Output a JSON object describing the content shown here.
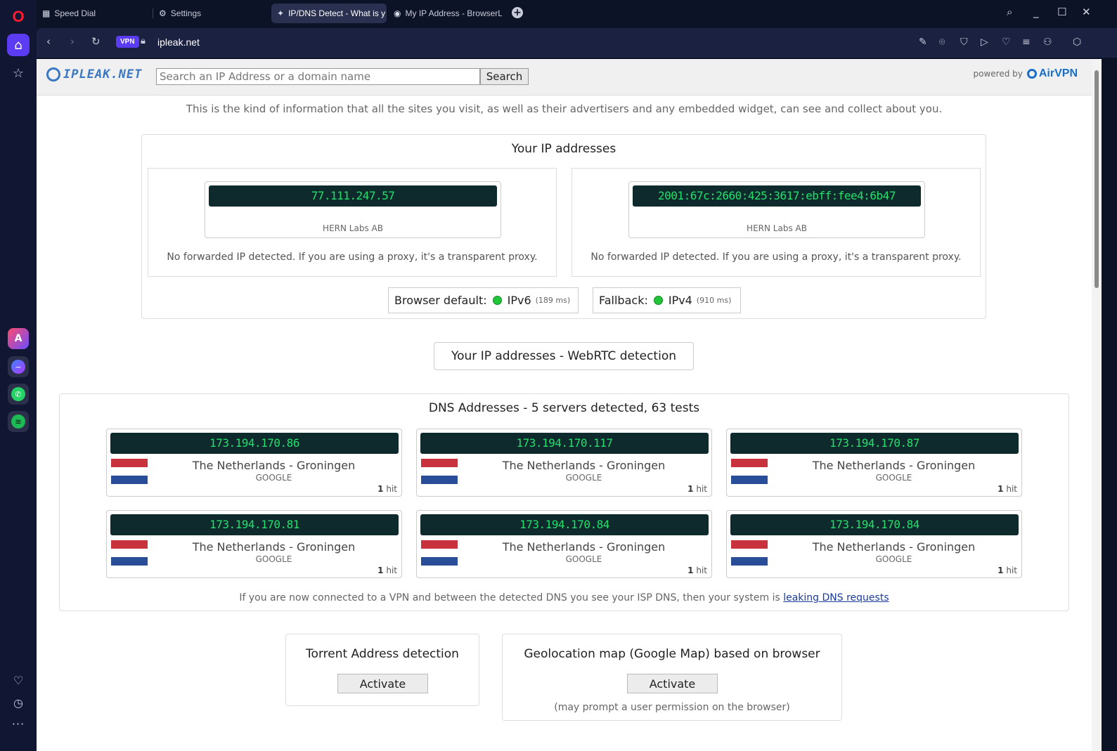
{
  "tabs": [
    {
      "label": "Speed Dial",
      "icon": "grid-icon"
    },
    {
      "label": "Settings",
      "icon": "gear-icon"
    },
    {
      "label": "IP/DNS Detect - What is y",
      "icon": "ipleak-favicon"
    },
    {
      "label": "My IP Address - BrowserL",
      "icon": "browserleaks-favicon"
    }
  ],
  "addressbar": {
    "vpn_label": "VPN",
    "url": "ipleak.net"
  },
  "site": {
    "logo_text": "IPLEAK.NET",
    "search_placeholder": "Search an IP Address or a domain name",
    "search_button": "Search",
    "powered_by": "powered by",
    "airvpn": "AirVPN"
  },
  "intro": "This is the kind of information that all the sites you visit, as well as their advertisers and any embedded widget, can see and collect about you.",
  "ip_section": {
    "title": "Your IP addresses",
    "addresses": [
      {
        "ip": "77.111.247.57",
        "isp": "HERN Labs AB",
        "forwarded": "No forwarded IP detected. If you are using a proxy, it's a transparent proxy."
      },
      {
        "ip": "2001:67c:2660:425:3617:ebff:fee4:6b47",
        "isp": "HERN Labs AB",
        "forwarded": "No forwarded IP detected. If you are using a proxy, it's a transparent proxy."
      }
    ],
    "browser_default": {
      "label": "Browser default:",
      "proto": "IPv6",
      "ms": "(189 ms)"
    },
    "fallback": {
      "label": "Fallback:",
      "proto": "IPv4",
      "ms": "(910 ms)"
    }
  },
  "webrtc_button": "Your IP addresses - WebRTC detection",
  "dns_section": {
    "title": "DNS Addresses - 5 servers detected, 63 tests",
    "servers": [
      {
        "ip": "173.194.170.86",
        "location": "The Netherlands - Groningen",
        "org": "GOOGLE",
        "hits": "1",
        "hit_label": "hit"
      },
      {
        "ip": "173.194.170.117",
        "location": "The Netherlands - Groningen",
        "org": "GOOGLE",
        "hits": "1",
        "hit_label": "hit"
      },
      {
        "ip": "173.194.170.87",
        "location": "The Netherlands - Groningen",
        "org": "GOOGLE",
        "hits": "1",
        "hit_label": "hit"
      },
      {
        "ip": "173.194.170.81",
        "location": "The Netherlands - Groningen",
        "org": "GOOGLE",
        "hits": "1",
        "hit_label": "hit"
      },
      {
        "ip": "173.194.170.84",
        "location": "The Netherlands - Groningen",
        "org": "GOOGLE",
        "hits": "1",
        "hit_label": "hit"
      },
      {
        "ip": "173.194.170.84",
        "location": "The Netherlands - Groningen",
        "org": "GOOGLE",
        "hits": "1",
        "hit_label": "hit"
      }
    ],
    "note": "If you are now connected to a VPN and between the detected DNS you see your ISP DNS, then your system is",
    "note_link": "leaking DNS requests"
  },
  "torrent": {
    "title": "Torrent Address detection",
    "button": "Activate"
  },
  "geolocation": {
    "title": "Geolocation map (Google Map) based on browser",
    "button": "Activate",
    "note": "(may prompt a user permission on the browser)"
  },
  "colors": {
    "lcd_bg": "#0e2a2c",
    "lcd_text": "#22e06b",
    "accent": "#5b3cf2",
    "status_dot": "#22c43a"
  }
}
